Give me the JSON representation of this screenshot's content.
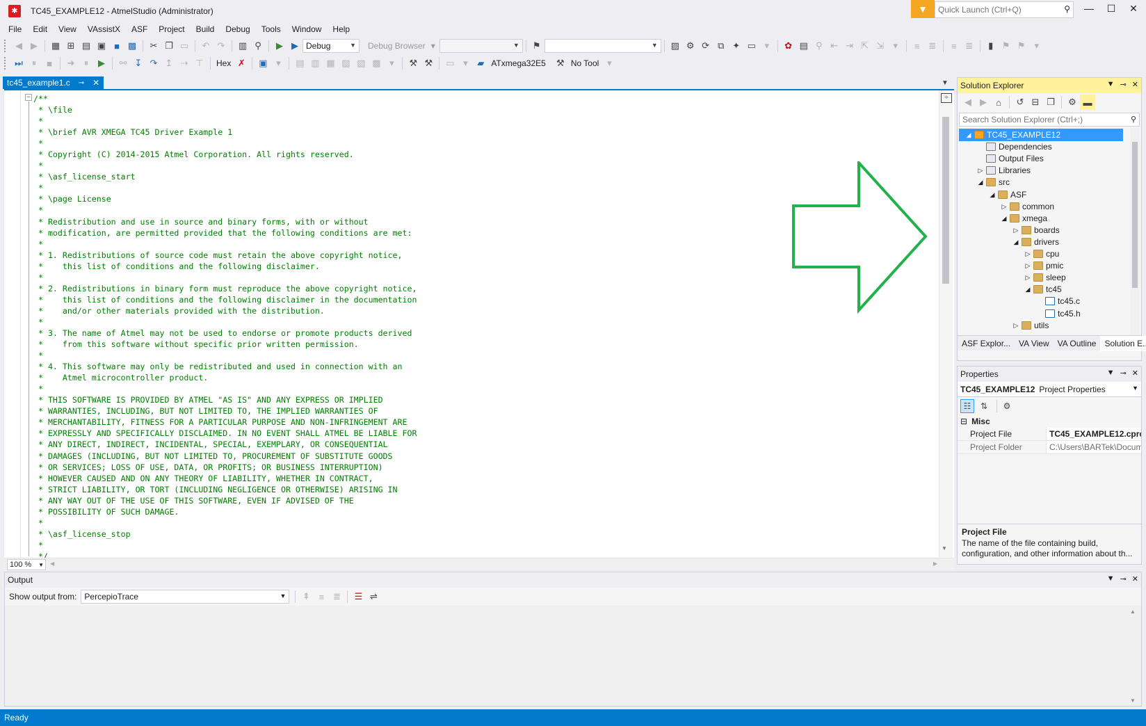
{
  "window": {
    "title": "TC45_EXAMPLE12 - AtmelStudio (Administrator)",
    "quick_launch_placeholder": "Quick Launch (Ctrl+Q)"
  },
  "menu": [
    "File",
    "Edit",
    "View",
    "VAssistX",
    "ASF",
    "Project",
    "Build",
    "Debug",
    "Tools",
    "Window",
    "Help"
  ],
  "toolbar1": {
    "config": "Debug",
    "debug_browser": "Debug Browser"
  },
  "toolbar2": {
    "hex": "Hex",
    "device": "ATxmega32E5",
    "tool": "No Tool"
  },
  "document_tab": {
    "label": "tc45_example1.c"
  },
  "editor": {
    "zoom": "100 %",
    "lines": [
      "/**",
      " * \\file",
      " *",
      " * \\brief AVR XMEGA TC45 Driver Example 1",
      " *",
      " * Copyright (C) 2014-2015 Atmel Corporation. All rights reserved.",
      " *",
      " * \\asf_license_start",
      " *",
      " * \\page License",
      " *",
      " * Redistribution and use in source and binary forms, with or without",
      " * modification, are permitted provided that the following conditions are met:",
      " *",
      " * 1. Redistributions of source code must retain the above copyright notice,",
      " *    this list of conditions and the following disclaimer.",
      " *",
      " * 2. Redistributions in binary form must reproduce the above copyright notice,",
      " *    this list of conditions and the following disclaimer in the documentation",
      " *    and/or other materials provided with the distribution.",
      " *",
      " * 3. The name of Atmel may not be used to endorse or promote products derived",
      " *    from this software without specific prior written permission.",
      " *",
      " * 4. This software may only be redistributed and used in connection with an",
      " *    Atmel microcontroller product.",
      " *",
      " * THIS SOFTWARE IS PROVIDED BY ATMEL \"AS IS\" AND ANY EXPRESS OR IMPLIED",
      " * WARRANTIES, INCLUDING, BUT NOT LIMITED TO, THE IMPLIED WARRANTIES OF",
      " * MERCHANTABILITY, FITNESS FOR A PARTICULAR PURPOSE AND NON-INFRINGEMENT ARE",
      " * EXPRESSLY AND SPECIFICALLY DISCLAIMED. IN NO EVENT SHALL ATMEL BE LIABLE FOR",
      " * ANY DIRECT, INDIRECT, INCIDENTAL, SPECIAL, EXEMPLARY, OR CONSEQUENTIAL",
      " * DAMAGES (INCLUDING, BUT NOT LIMITED TO, PROCUREMENT OF SUBSTITUTE GOODS",
      " * OR SERVICES; LOSS OF USE, DATA, OR PROFITS; OR BUSINESS INTERRUPTION)",
      " * HOWEVER CAUSED AND ON ANY THEORY OF LIABILITY, WHETHER IN CONTRACT,",
      " * STRICT LIABILITY, OR TORT (INCLUDING NEGLIGENCE OR OTHERWISE) ARISING IN",
      " * ANY WAY OUT OF THE USE OF THIS SOFTWARE, EVEN IF ADVISED OF THE",
      " * POSSIBILITY OF SUCH DAMAGE.",
      " *",
      " * \\asf_license_stop",
      " *",
      " */"
    ]
  },
  "solution_explorer": {
    "title": "Solution Explorer",
    "search_placeholder": "Search Solution Explorer (Ctrl+;)",
    "tree": [
      {
        "label": "TC45_EXAMPLE12",
        "depth": 0,
        "expander": "◢",
        "icon": "project-icon",
        "selected": true
      },
      {
        "label": "Dependencies",
        "depth": 1,
        "expander": "",
        "icon": "reference-icon"
      },
      {
        "label": "Output Files",
        "depth": 1,
        "expander": "",
        "icon": "reference-icon"
      },
      {
        "label": "Libraries",
        "depth": 1,
        "expander": "▷",
        "icon": "reference-icon"
      },
      {
        "label": "src",
        "depth": 1,
        "expander": "◢",
        "icon": "folder-icon"
      },
      {
        "label": "ASF",
        "depth": 2,
        "expander": "◢",
        "icon": "folder-icon"
      },
      {
        "label": "common",
        "depth": 3,
        "expander": "▷",
        "icon": "folder-icon"
      },
      {
        "label": "xmega",
        "depth": 3,
        "expander": "◢",
        "icon": "folder-icon"
      },
      {
        "label": "boards",
        "depth": 4,
        "expander": "▷",
        "icon": "folder-icon"
      },
      {
        "label": "drivers",
        "depth": 4,
        "expander": "◢",
        "icon": "folder-icon"
      },
      {
        "label": "cpu",
        "depth": 5,
        "expander": "▷",
        "icon": "folder-icon"
      },
      {
        "label": "pmic",
        "depth": 5,
        "expander": "▷",
        "icon": "folder-icon"
      },
      {
        "label": "sleep",
        "depth": 5,
        "expander": "▷",
        "icon": "folder-icon"
      },
      {
        "label": "tc45",
        "depth": 5,
        "expander": "◢",
        "icon": "folder-icon"
      },
      {
        "label": "tc45.c",
        "depth": 6,
        "expander": "",
        "icon": "c-file-icon"
      },
      {
        "label": "tc45.h",
        "depth": 6,
        "expander": "",
        "icon": "h-file-icon"
      },
      {
        "label": "utils",
        "depth": 4,
        "expander": "▷",
        "icon": "folder-icon"
      }
    ],
    "tabs": [
      "ASF Explor...",
      "VA View",
      "VA Outline",
      "Solution E..."
    ]
  },
  "properties": {
    "title": "Properties",
    "object_name": "TC45_EXAMPLE12",
    "object_type": "Project Properties",
    "category": "Misc",
    "rows": [
      {
        "name": "Project File",
        "value": "TC45_EXAMPLE12.cproj"
      },
      {
        "name": "Project Folder",
        "value": "C:\\Users\\BARTek\\Docum"
      }
    ],
    "desc_title": "Project File",
    "desc_text": "The name of the file containing build, configuration, and other information about th..."
  },
  "output": {
    "title": "Output",
    "show_label": "Show output from:",
    "source": "PercepioTrace"
  },
  "status": {
    "text": "Ready"
  },
  "colors": {
    "accent": "#007acc",
    "arrow": "#22b14c",
    "code_comment": "#008000",
    "active_panel": "#fff29d"
  }
}
